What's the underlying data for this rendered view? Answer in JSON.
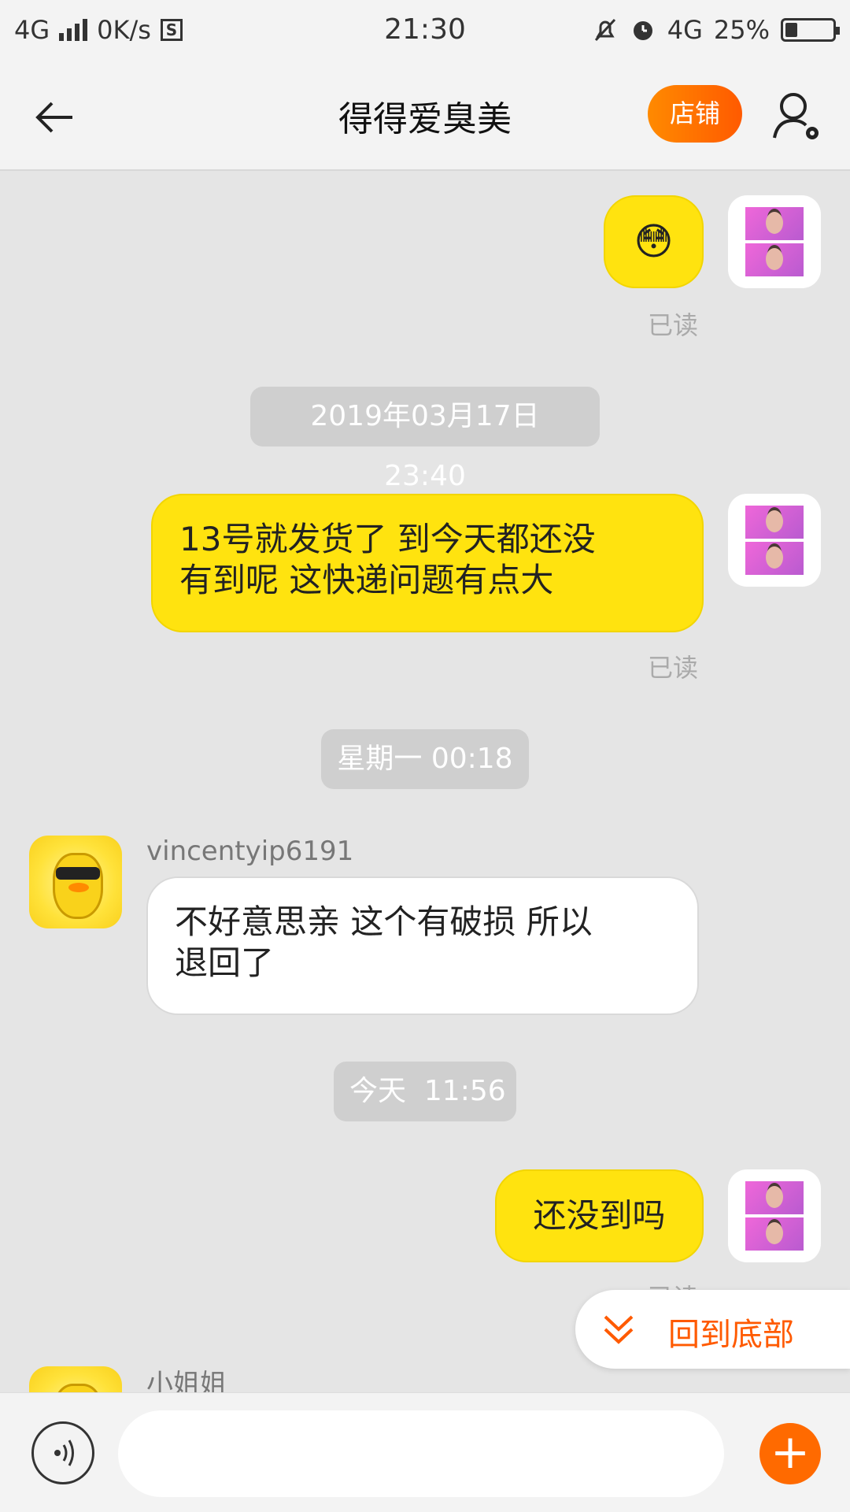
{
  "status_bar": {
    "network": "4G",
    "speed": "0K/s",
    "sd_icon_text": "S",
    "time": "21:30",
    "network_right": "4G",
    "battery": "25%",
    "battery_level": 0.25
  },
  "header": {
    "title": "得得爱臭美",
    "shop_label": "店铺"
  },
  "messages": {
    "m1": {
      "emoji": "😳",
      "read": "已读"
    },
    "t1": "2019年03月17日 23:40",
    "m2": {
      "line1": "13号就发货了 到今天都还没",
      "line2": "有到呢 这快递问题有点大",
      "read": "已读"
    },
    "t2": "星期一 00:18",
    "m3": {
      "sender": "vincentyip6191",
      "line1": "不好意思亲 这个有破损 所以",
      "line2": "退回了"
    },
    "t3": "今天  11:56",
    "m4": {
      "text": "还没到吗",
      "read": "已读"
    },
    "m5": {
      "sender": "小姐姐"
    }
  },
  "back_to_bottom": "回到底部",
  "input": {
    "placeholder": ""
  },
  "colors": {
    "accent": "#ff5a00",
    "bubble_me": "#ffe30f"
  }
}
